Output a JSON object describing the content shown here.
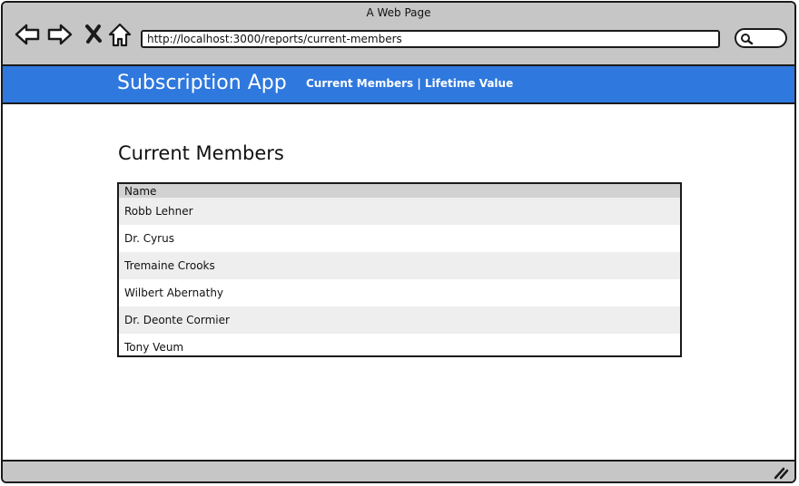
{
  "window": {
    "title": "A Web Page"
  },
  "browser": {
    "url": "http://localhost:3000/reports/current-members"
  },
  "app": {
    "title": "Subscription App",
    "nav": [
      {
        "label": "Current Members"
      },
      {
        "label": "Lifetime Value"
      }
    ],
    "nav_separator": " | "
  },
  "page": {
    "heading": "Current Members",
    "table": {
      "columns": [
        "Name"
      ],
      "rows": [
        "Robb Lehner",
        "Dr. Cyrus",
        "Tremaine Crooks",
        "Wilbert Abernathy",
        "Dr. Deonte Cormier",
        "Tony Veum"
      ]
    }
  },
  "colors": {
    "chrome": "#c6c6c6",
    "app_bar": "#2f78de",
    "row_alt": "#eeeeee",
    "header_bg": "#d2d2d2"
  },
  "icons": [
    "back-arrow-icon",
    "forward-arrow-icon",
    "close-x-icon",
    "home-icon",
    "search-icon",
    "resize-grip-icon"
  ]
}
